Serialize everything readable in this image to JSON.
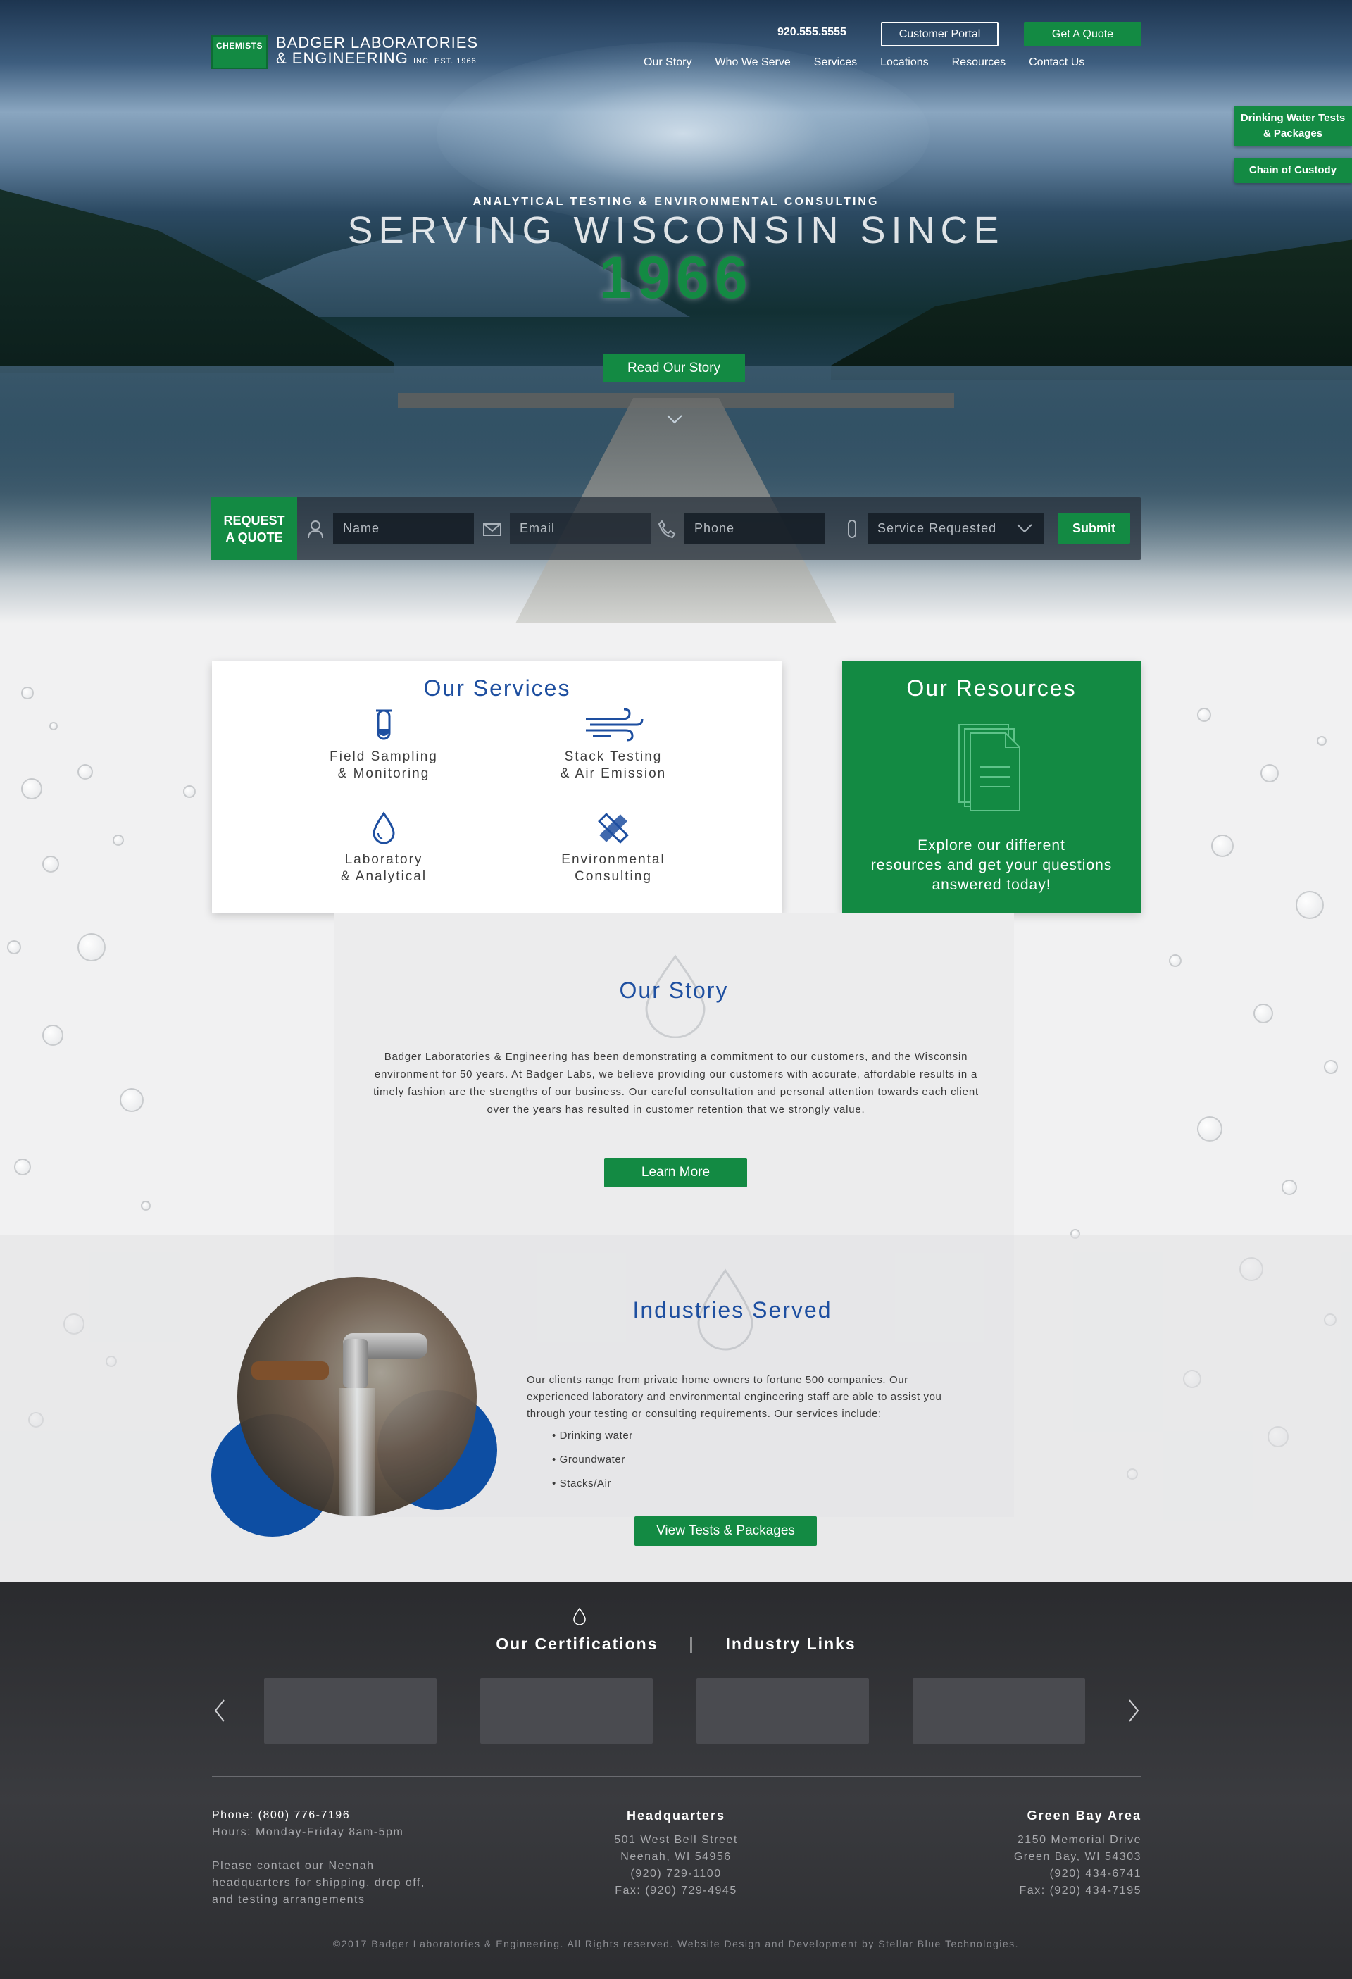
{
  "header": {
    "logo_badge": "CHEMISTS",
    "logo_line1": "BADGER LABORATORIES",
    "logo_line2": "& ENGINEERING",
    "logo_suffix": "INC. EST. 1966",
    "phone": "920.555.5555",
    "portal_label": "Customer Portal",
    "quote_label": "Get A Quote",
    "nav": [
      "Our Story",
      "Who We Serve",
      "Services",
      "Locations",
      "Resources",
      "Contact Us"
    ]
  },
  "side_tabs": [
    "Drinking Water Tests & Packages",
    "Chain of Custody"
  ],
  "hero": {
    "kicker": "ANALYTICAL TESTING & ENVIRONMENTAL CONSULTING",
    "title": "SERVING WISCONSIN SINCE",
    "year": "1966",
    "cta": "Read Our Story"
  },
  "quote_form": {
    "label": "REQUEST A QUOTE",
    "name_placeholder": "Name",
    "email_placeholder": "Email",
    "phone_placeholder": "Phone",
    "service_placeholder": "Service Requested",
    "submit": "Submit"
  },
  "services": {
    "title": "Our Services",
    "items": [
      {
        "label": "Field Sampling\n& Monitoring",
        "icon": "test-tube-icon"
      },
      {
        "label": "Stack Testing\n& Air Emission",
        "icon": "wind-icon"
      },
      {
        "label": "Laboratory\n& Analytical",
        "icon": "water-drop-icon"
      },
      {
        "label": "Environmental\nConsulting",
        "icon": "tools-icon"
      }
    ]
  },
  "resources": {
    "title": "Our Resources",
    "text": "Explore our different\nresources and get your questions\nanswered today!",
    "icon": "documents-icon"
  },
  "story": {
    "title": "Our Story",
    "body": "Badger Laboratories & Engineering has been demonstrating a commitment to our customers, and the Wisconsin environment for 50 years. At Badger Labs, we believe providing our customers with accurate, affordable results in a timely fashion are the strengths of our business. Our careful consultation and personal attention towards each client over the years has resulted in customer retention that we strongly value.",
    "cta": "Learn More"
  },
  "industries": {
    "title": "Industries Served",
    "body": "Our clients range from private home owners to fortune 500 companies. Our experienced laboratory and environmental engineering staff are able to assist you through your testing or consulting requirements. Our services include:",
    "list": [
      "Drinking water",
      "Groundwater",
      "Stacks/Air"
    ],
    "cta": "View Tests & Packages"
  },
  "footer": {
    "tab_certifications": "Our Certifications",
    "tab_separator": "|",
    "tab_links": "Industry Links",
    "phone_label": "Phone:",
    "phone": "(800) 776-7196",
    "hours": "Hours: Monday-Friday 8am-5pm",
    "note": "Please contact our Neenah headquarters for shipping, drop off, and testing arrangements",
    "hq": {
      "title": "Headquarters",
      "lines": [
        "501 West Bell Street",
        "Neenah, WI 54956",
        "(920) 729-1100",
        "Fax: (920) 729-4945"
      ]
    },
    "gb": {
      "title": "Green Bay Area",
      "lines": [
        "2150 Memorial Drive",
        "Green Bay, WI 54303",
        "(920) 434-6741",
        "Fax: (920) 434-7195"
      ]
    },
    "copyright": "©2017 Badger Laboratories & Engineering. All Rights reserved. Website Design and Development by Stellar Blue Technologies."
  },
  "colors": {
    "brand_green": "#138a43",
    "brand_blue": "#1e4fa0",
    "footer_bg": "#333438"
  }
}
